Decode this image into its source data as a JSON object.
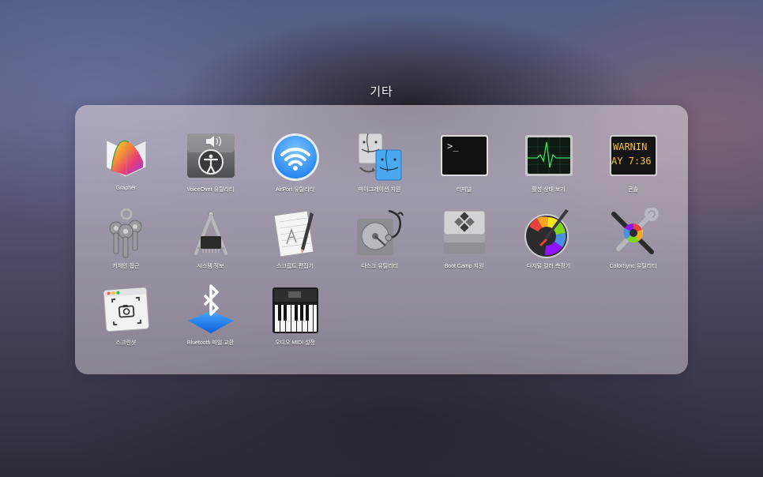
{
  "folder": {
    "title": "기타"
  },
  "apps": [
    {
      "id": "grapher",
      "label": "Grapher",
      "icon": "grapher-icon"
    },
    {
      "id": "voiceover",
      "label": "VoiceOver 유틸리티",
      "icon": "voiceover-utility-icon"
    },
    {
      "id": "airport",
      "label": "AirPort 유틸리티",
      "icon": "airport-utility-icon"
    },
    {
      "id": "migration",
      "label": "마이그레이션 지원",
      "icon": "migration-assistant-icon"
    },
    {
      "id": "terminal",
      "label": "터미널",
      "icon": "terminal-icon",
      "prompt": ">_"
    },
    {
      "id": "activity",
      "label": "활성 상태 보기",
      "icon": "activity-monitor-icon"
    },
    {
      "id": "console",
      "label": "콘솔",
      "icon": "console-icon",
      "line1": "WARNIN",
      "line2": "AY 7:36"
    },
    {
      "id": "keychain",
      "label": "키체인 접근",
      "icon": "keychain-access-icon"
    },
    {
      "id": "sysinfo",
      "label": "시스템 정보",
      "icon": "system-information-icon"
    },
    {
      "id": "scripteditor",
      "label": "스크립트 편집기",
      "icon": "script-editor-icon"
    },
    {
      "id": "diskutil",
      "label": "디스크 유틸리티",
      "icon": "disk-utility-icon"
    },
    {
      "id": "bootcamp",
      "label": "Boot Camp 지원",
      "icon": "boot-camp-icon"
    },
    {
      "id": "colormeter",
      "label": "디지털 컬러 측정기",
      "icon": "digital-color-meter-icon"
    },
    {
      "id": "colorsync",
      "label": "ColorSync 유틸리티",
      "icon": "colorsync-utility-icon"
    },
    {
      "id": "screenshot",
      "label": "스크린샷",
      "icon": "screenshot-icon"
    },
    {
      "id": "bluetooth",
      "label": "Bluetooth 파일 교환",
      "icon": "bluetooth-file-exchange-icon"
    },
    {
      "id": "audiomidi",
      "label": "오디오 MIDI 설정",
      "icon": "audio-midi-setup-icon"
    }
  ],
  "colors": {
    "panel": "#c8bcc8",
    "label": "#ffffff",
    "accent_blue": "#1d7ff0"
  }
}
